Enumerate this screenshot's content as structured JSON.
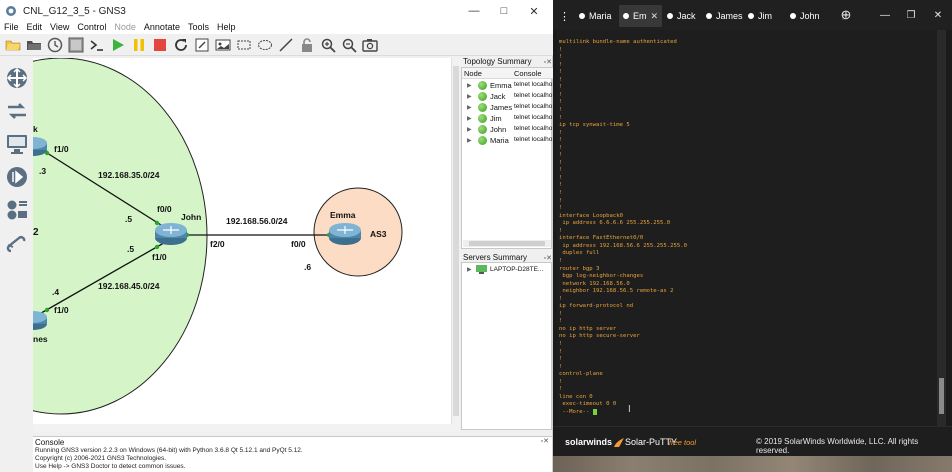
{
  "gns3": {
    "window_title": "CNL_G12_3_5 - GNS3",
    "menu": [
      "File",
      "Edit",
      "View",
      "Control",
      "Node",
      "Annotate",
      "Tools",
      "Help"
    ],
    "menu_disabled": [
      "Node"
    ],
    "toolbar_icons": [
      "open-folder-icon",
      "folder-icon",
      "snapshot-clock-icon",
      "show-interface-labels-icon",
      "console-all-icon",
      "start-all-icon",
      "suspend-all-icon",
      "stop-all-icon",
      "reload-all-icon",
      "add-note-icon",
      "insert-image-icon",
      "draw-rectangle-icon",
      "draw-ellipse-icon",
      "draw-line-icon",
      "lock-icon",
      "zoom-in-icon",
      "zoom-out-icon",
      "screenshot-icon"
    ],
    "left_dock_icons": [
      "browse-routers-icon",
      "browse-switches-icon",
      "browse-end-devices-icon",
      "browse-security-devices-icon",
      "browse-all-devices-icon",
      "add-link-icon"
    ],
    "topology": {
      "nodes": {
        "john": "John",
        "emma": "Emma",
        "partial_top": "k",
        "partial_bottom": "nes"
      },
      "zones": {
        "as3": "AS3",
        "left_partial": "2"
      },
      "labels": {
        "f1_0_top": "f1/0",
        "dot3": ".3",
        "net_35": "192.168.35.0/24",
        "f0_0_john": "f0/0",
        "dot5_top": ".5",
        "net_56": "192.168.56.0/24",
        "f2_0": "f2/0",
        "f0_0_emma": "f0/0",
        "dot6": ".6",
        "dot5_bottom": ".5",
        "f1_0_john": "f1/0",
        "net_45": "192.168.45.0/24",
        "dot4": ".4",
        "f1_0_bottom": "f1/0"
      },
      "colors": {
        "as_big_zone": "#d5f5c9",
        "as3_zone": "#fcdcc4"
      }
    },
    "topology_summary": {
      "title": "Topology Summary",
      "col_node": "Node",
      "col_console": "Console",
      "rows": [
        {
          "name": "Emma",
          "console": "telnet localho"
        },
        {
          "name": "Jack",
          "console": "telnet localho"
        },
        {
          "name": "James",
          "console": "telnet localho"
        },
        {
          "name": "Jim",
          "console": "telnet localho"
        },
        {
          "name": "John",
          "console": "telnet localho"
        },
        {
          "name": "Maria",
          "console": "telnet localho"
        }
      ]
    },
    "servers_summary": {
      "title": "Servers Summary",
      "server": "LAPTOP-D28TE..."
    },
    "console": {
      "title": "Console",
      "lines": [
        "Running GNS3 version 2.2.3 on Windows (64-bit) with Python 3.6.8 Qt 5.12.1 and PyQt 5.12.",
        "Copyright (c) 2006-2021 GNS3 Technologies.",
        "Use Help -> GNS3 Doctor to detect common issues."
      ]
    }
  },
  "putty": {
    "tabs": [
      {
        "label": "Maria",
        "active": false
      },
      {
        "label": "Em",
        "active": true
      },
      {
        "label": "Jack",
        "active": false
      },
      {
        "label": "James",
        "active": false
      },
      {
        "label": "Jim",
        "active": false
      },
      {
        "label": "John",
        "active": false
      }
    ],
    "terminal_lines": [
      "multilink bundle-name authenticated",
      "!",
      "!",
      "!",
      "!",
      "!",
      "!",
      "!",
      "!",
      "!",
      "!",
      "ip tcp synwait-time 5",
      "!",
      "!",
      "!",
      "!",
      "!",
      "!",
      "!",
      "!",
      "!",
      "!",
      "!",
      "interface Loopback0",
      " ip address 6.6.6.6 255.255.255.0",
      "!",
      "interface FastEthernet0/0",
      " ip address 192.168.56.6 255.255.255.0",
      " duplex full",
      "!",
      "router bgp 3",
      " bgp log-neighbor-changes",
      " network 192.168.56.0",
      " neighbor 192.168.56.5 remote-as 2",
      "!",
      "ip forward-protocol nd",
      "!",
      "!",
      "no ip http server",
      "no ip http secure-server",
      "!",
      "!",
      "!",
      "!",
      "control-plane",
      "!",
      "!",
      "line con 0",
      " exec-timeout 0 0",
      " --More-- "
    ],
    "footer": {
      "brand": "solarwinds",
      "product": "Solar-PuTTY",
      "product_tag": "free tool",
      "copyright": "© 2019 SolarWinds Worldwide, LLC. All rights reserved."
    },
    "colors": {
      "terminal_text": "#e8a33c",
      "brand_orange": "#f39c32"
    }
  }
}
